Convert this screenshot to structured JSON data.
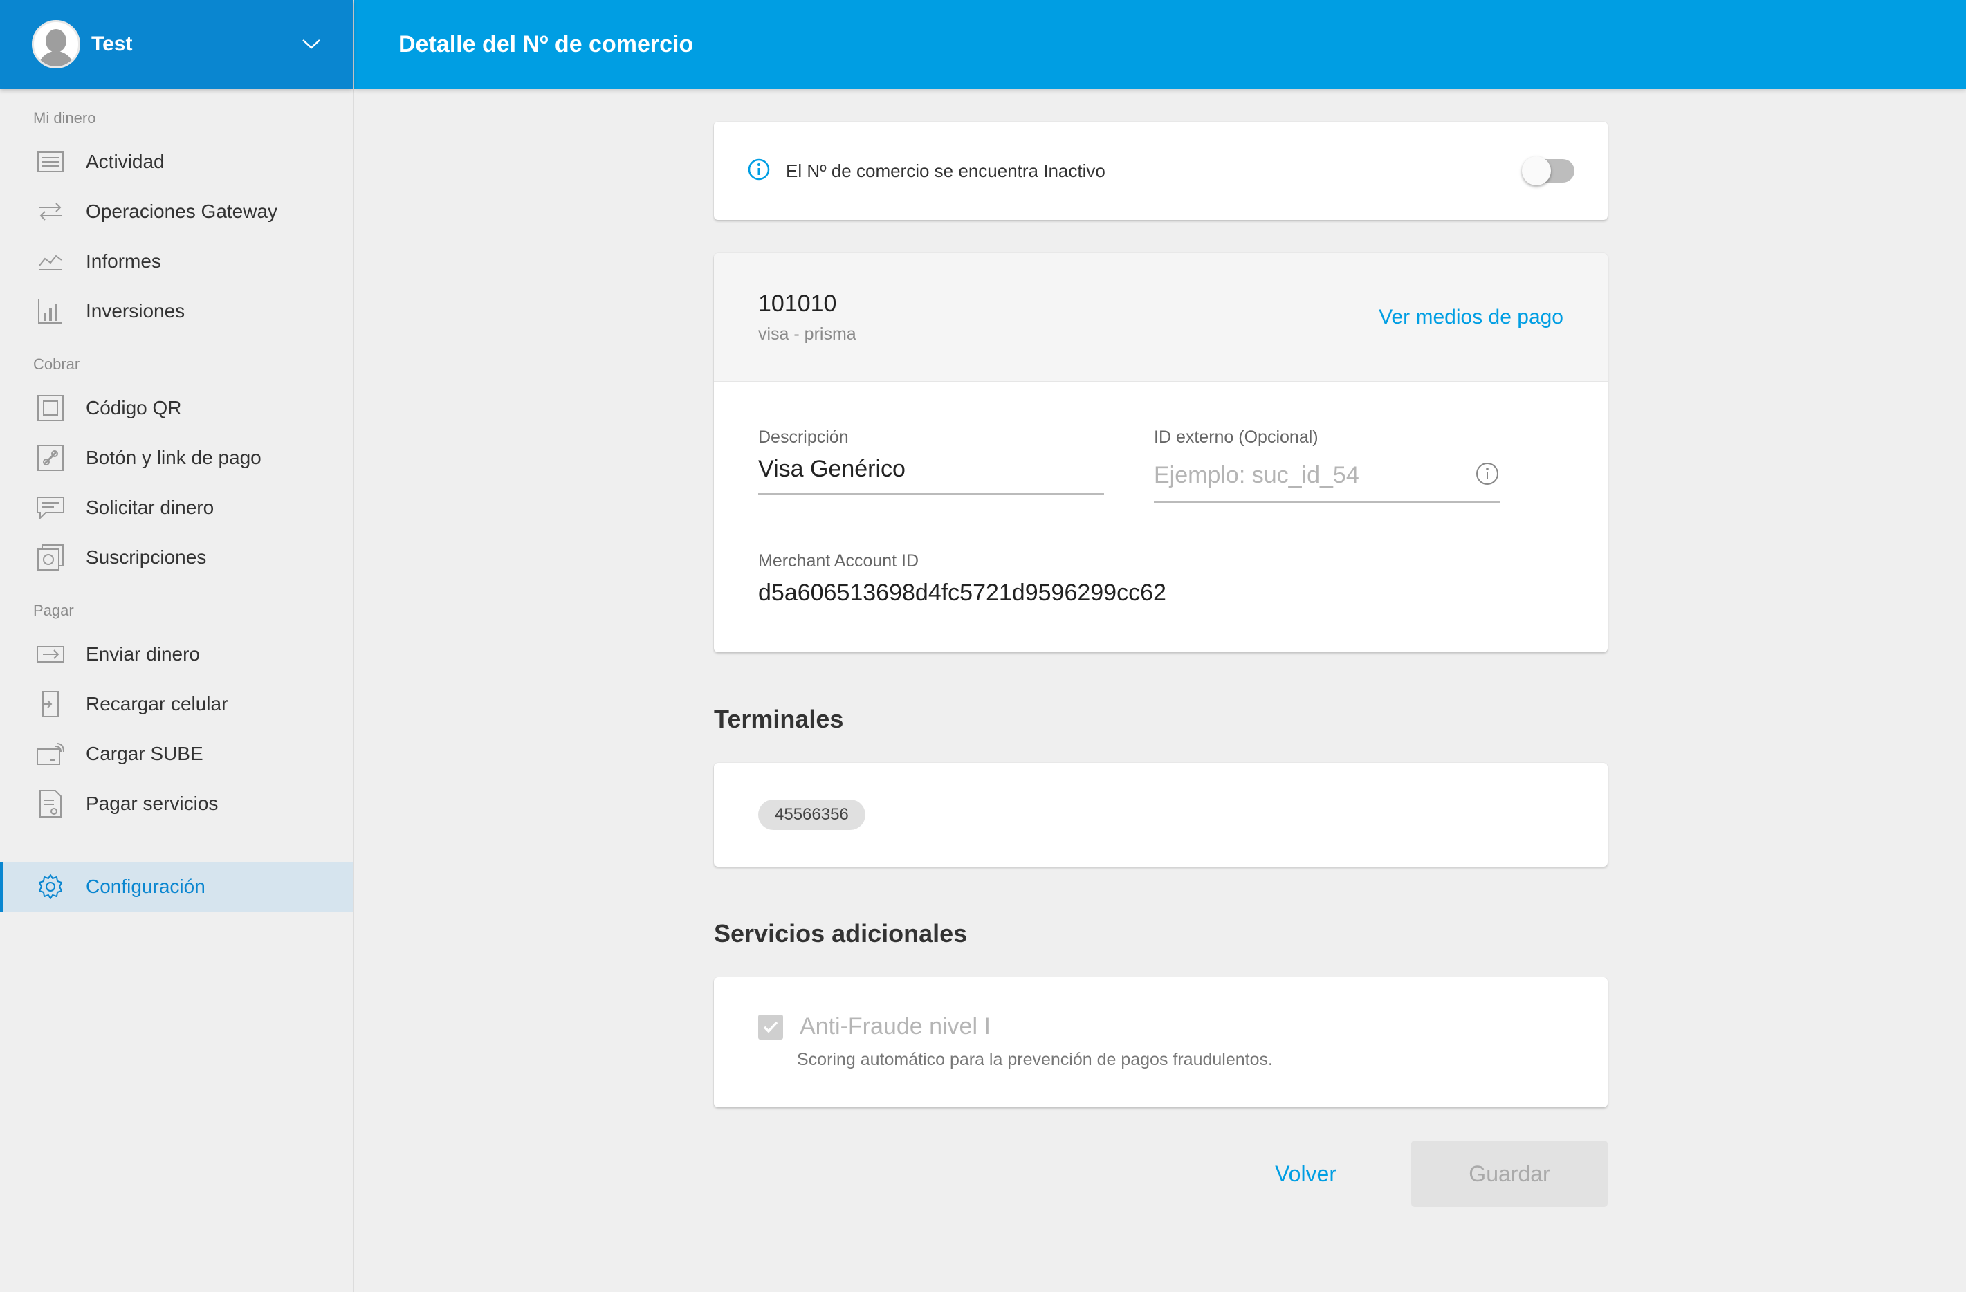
{
  "user": {
    "name": "Test"
  },
  "header": {
    "title": "Detalle del Nº de comercio"
  },
  "sidebar": {
    "sections": [
      {
        "title": "Mi dinero",
        "items": [
          {
            "label": "Actividad",
            "icon": "list-icon"
          },
          {
            "label": "Operaciones Gateway",
            "icon": "arrows-icon"
          },
          {
            "label": "Informes",
            "icon": "chart-line-icon"
          },
          {
            "label": "Inversiones",
            "icon": "bar-chart-icon"
          }
        ]
      },
      {
        "title": "Cobrar",
        "items": [
          {
            "label": "Código QR",
            "icon": "qr-icon"
          },
          {
            "label": "Botón y link de pago",
            "icon": "link-icon"
          },
          {
            "label": "Solicitar dinero",
            "icon": "message-icon"
          },
          {
            "label": "Suscripciones",
            "icon": "subscription-icon"
          }
        ]
      },
      {
        "title": "Pagar",
        "items": [
          {
            "label": "Enviar dinero",
            "icon": "send-icon"
          },
          {
            "label": "Recargar celular",
            "icon": "phone-icon"
          },
          {
            "label": "Cargar SUBE",
            "icon": "card-icon"
          },
          {
            "label": "Pagar servicios",
            "icon": "bill-icon"
          }
        ]
      }
    ],
    "config": {
      "label": "Configuración",
      "icon": "gear-icon"
    }
  },
  "status": {
    "text": "El Nº de comercio se encuentra Inactivo",
    "active": false
  },
  "merchant": {
    "number": "101010",
    "subtitle": "visa - prisma",
    "payment_methods_link": "Ver medios de pago",
    "description_label": "Descripción",
    "description_value": "Visa Genérico",
    "external_id_label": "ID externo (Opcional)",
    "external_id_placeholder": "Ejemplo: suc_id_54",
    "merchant_account_label": "Merchant Account ID",
    "merchant_account_value": "d5a606513698d4fc5721d9596299cc62"
  },
  "terminals": {
    "title": "Terminales",
    "items": [
      "45566356"
    ]
  },
  "services": {
    "title": "Servicios adicionales",
    "antifraud_label": "Anti-Fraude nivel I",
    "antifraud_desc": "Scoring automático para la prevención de pagos fraudulentos.",
    "antifraud_checked": true
  },
  "actions": {
    "back": "Volver",
    "save": "Guardar"
  },
  "colors": {
    "header": "#009ee3",
    "user_bar": "#0a86d0",
    "accent": "#009ee3"
  }
}
